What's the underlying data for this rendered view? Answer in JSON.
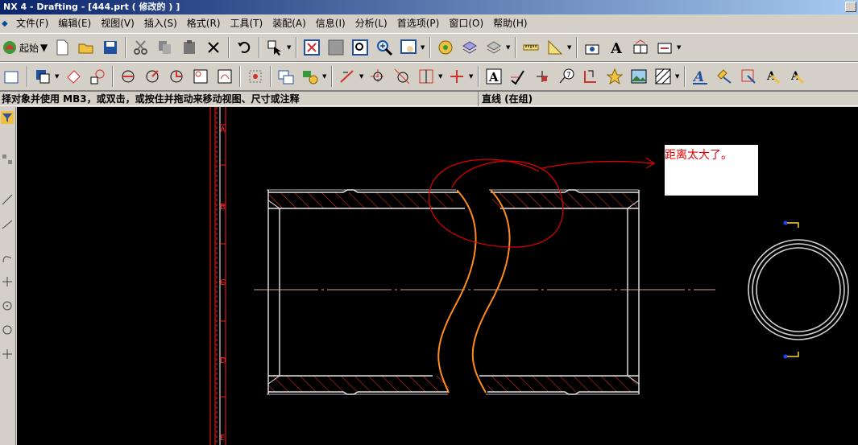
{
  "window": {
    "title": "NX 4 - Drafting - [444.prt ( 修改的 ) ]"
  },
  "menu": {
    "items": [
      "文件(F)",
      "编辑(E)",
      "视图(V)",
      "插入(S)",
      "格式(R)",
      "工具(T)",
      "装配(A)",
      "信息(I)",
      "分析(L)",
      "首选项(P)",
      "窗口(O)",
      "帮助(H)"
    ]
  },
  "toolbar": {
    "start_label": "起始"
  },
  "cue_line": {
    "text": "择对象并使用 MB3，或双击，或按住并拖动来移动视图、尺寸或注释"
  },
  "status_line": {
    "text": "直线 (在组)"
  },
  "drawing": {
    "border_zone_labels": [
      "A",
      "B",
      "C",
      "D",
      "E"
    ],
    "annotation_note": "距离太大了。",
    "colors": {
      "background": "#000000",
      "geometry": "#e6e6e6",
      "break_line": "#ff8c1a",
      "hatch": "#ff3030",
      "markup": "#e00000",
      "border": "#ff2020",
      "centerline": "#c8a08c",
      "view_marker": "#2040ff"
    }
  }
}
